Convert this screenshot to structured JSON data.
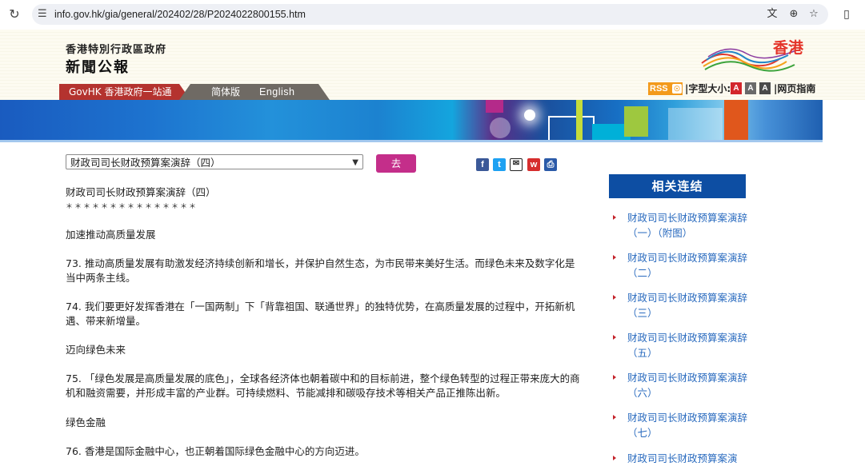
{
  "browser": {
    "url": "info.gov.hk/gia/general/202402/28/P2024022800155.htm",
    "reload_icon": "reload-icon",
    "site_info_icon": "tune-icon",
    "icons": [
      "translate-icon",
      "zoom-icon",
      "bookmark-star-icon",
      "extensions-icon"
    ]
  },
  "header": {
    "org_name": "香港特別行政區政府",
    "title": "新聞公報",
    "logo_text": "香港",
    "nav": {
      "govhk": "GovHK 香港政府一站通",
      "simplified": "简体版",
      "english": "English"
    },
    "tools": {
      "rss": "RSS",
      "font_size_label": "|字型大小:",
      "font_size_buttons": [
        "A",
        "A",
        "A"
      ],
      "page_guide": "|网页指南"
    },
    "colors": {
      "govhk_tab": "#b4332f",
      "lang_tab": "#6f6a64",
      "rss": "#f39a1b"
    }
  },
  "toolbar": {
    "select_value": "财政司司长财政预算案演辞（四）",
    "go_label": "去",
    "share_icons": [
      "facebook-icon",
      "twitter-icon",
      "email-icon",
      "weibo-icon",
      "print-icon"
    ]
  },
  "article": {
    "title": "财政司司长财政预算案演辞（四）",
    "stars": "＊＊＊＊＊＊＊＊＊＊＊＊＊＊＊",
    "paragraphs": [
      "加速推动高质量发展",
      "73. 推动高质量发展有助激发经济持续创新和增长，并保护自然生态，为市民带来美好生活。而绿色未来及数字化是当中两条主线。",
      "74. 我们要更好发挥香港在「一国两制」下「背靠祖国、联通世界」的独特优势，在高质量发展的过程中，开拓新机遇、带来新增量。",
      "迈向绿色未来",
      "75. 「绿色发展是高质量发展的底色」，全球各经济体也朝着碳中和的目标前进，整个绿色转型的过程正带来庞大的商机和融资需要，并形成丰富的产业群。可持续燃料、节能减排和碳吸存技术等相关产品正推陈出新。",
      "绿色金融",
      "76. 香港是国际金融中心，也正朝着国际绿色金融中心的方向迈进。"
    ]
  },
  "related": {
    "title": "相关连结",
    "links": [
      "财政司司长财政预算案演辞（一）（附图）",
      "财政司司长财政预算案演辞（二）",
      "财政司司长财政预算案演辞（三）",
      "财政司司长财政预算案演辞（五）",
      "财政司司长财政预算案演辞（六）",
      "财政司司长财政预算案演辞（七）",
      "财政司司长财政预算案演"
    ]
  }
}
